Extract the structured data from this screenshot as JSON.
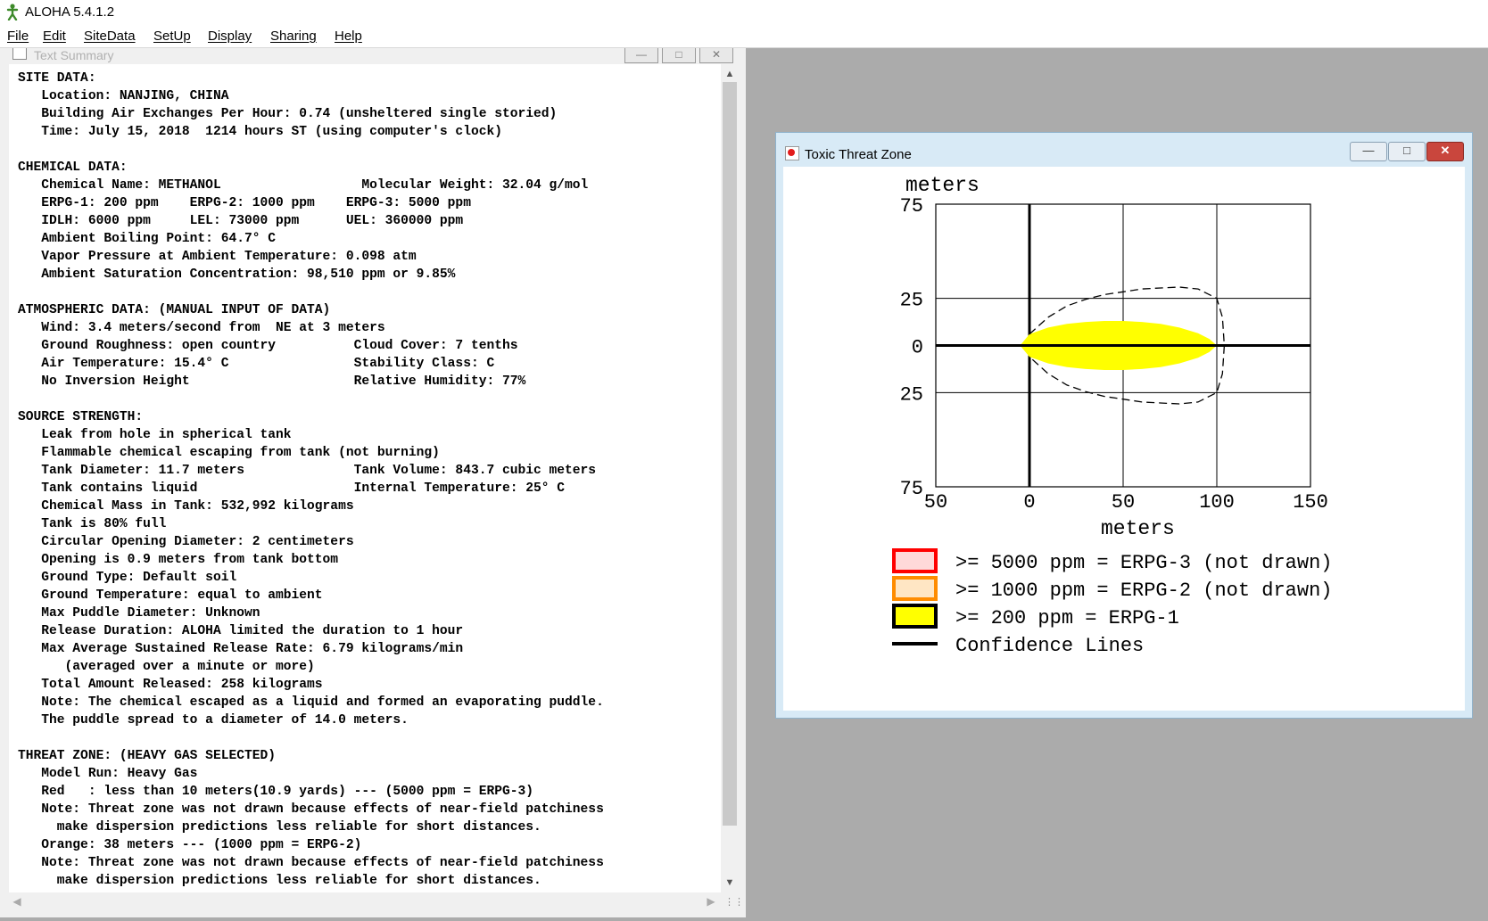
{
  "app": {
    "title": "ALOHA 5.4.1.2",
    "menu": [
      "File",
      "Edit",
      "SiteData",
      "SetUp",
      "Display",
      "Sharing",
      "Help"
    ]
  },
  "text_summary": {
    "title": "Text Summary",
    "lines": [
      "SITE DATA:",
      "   Location: NANJING, CHINA",
      "   Building Air Exchanges Per Hour: 0.74 (unsheltered single storied)",
      "   Time: July 15, 2018  1214 hours ST (using computer's clock)",
      "",
      "CHEMICAL DATA:",
      "   Chemical Name: METHANOL                  Molecular Weight: 32.04 g/mol",
      "   ERPG-1: 200 ppm    ERPG-2: 1000 ppm    ERPG-3: 5000 ppm",
      "   IDLH: 6000 ppm     LEL: 73000 ppm      UEL: 360000 ppm",
      "   Ambient Boiling Point: 64.7° C",
      "   Vapor Pressure at Ambient Temperature: 0.098 atm",
      "   Ambient Saturation Concentration: 98,510 ppm or 9.85%",
      "",
      "ATMOSPHERIC DATA: (MANUAL INPUT OF DATA)",
      "   Wind: 3.4 meters/second from  NE at 3 meters",
      "   Ground Roughness: open country          Cloud Cover: 7 tenths",
      "   Air Temperature: 15.4° C                Stability Class: C",
      "   No Inversion Height                     Relative Humidity: 77%",
      "",
      "SOURCE STRENGTH:",
      "   Leak from hole in spherical tank",
      "   Flammable chemical escaping from tank (not burning)",
      "   Tank Diameter: 11.7 meters              Tank Volume: 843.7 cubic meters",
      "   Tank contains liquid                    Internal Temperature: 25° C",
      "   Chemical Mass in Tank: 532,992 kilograms",
      "   Tank is 80% full",
      "   Circular Opening Diameter: 2 centimeters",
      "   Opening is 0.9 meters from tank bottom",
      "   Ground Type: Default soil",
      "   Ground Temperature: equal to ambient",
      "   Max Puddle Diameter: Unknown",
      "   Release Duration: ALOHA limited the duration to 1 hour",
      "   Max Average Sustained Release Rate: 6.79 kilograms/min",
      "      (averaged over a minute or more)",
      "   Total Amount Released: 258 kilograms",
      "   Note: The chemical escaped as a liquid and formed an evaporating puddle.",
      "   The puddle spread to a diameter of 14.0 meters.",
      "",
      "THREAT ZONE: (HEAVY GAS SELECTED)",
      "   Model Run: Heavy Gas",
      "   Red   : less than 10 meters(10.9 yards) --- (5000 ppm = ERPG-3)",
      "   Note: Threat zone was not drawn because effects of near-field patchiness",
      "     make dispersion predictions less reliable for short distances.",
      "   Orange: 38 meters --- (1000 ppm = ERPG-2)",
      "   Note: Threat zone was not drawn because effects of near-field patchiness",
      "     make dispersion predictions less reliable for short distances."
    ]
  },
  "threat_zone": {
    "title": "Toxic Threat Zone",
    "icon": "red-dot-icon",
    "legend": [
      {
        "label": ">= 5000 ppm = ERPG-3 (not drawn)",
        "color": "#ff0000"
      },
      {
        "label": ">= 1000 ppm = ERPG-2 (not drawn)",
        "color": "#ff8c00"
      },
      {
        "label": ">= 200 ppm = ERPG-1",
        "color": "#ffff00"
      },
      {
        "label": "Confidence Lines",
        "color": "#000000"
      }
    ]
  },
  "chart_data": {
    "type": "area",
    "xlabel": "meters",
    "ylabel": "meters",
    "xlim": [
      -50,
      150
    ],
    "ylim": [
      -75,
      75
    ],
    "x_ticks": [
      "50",
      "0",
      "50",
      "100",
      "150"
    ],
    "y_ticks": [
      "75",
      "25",
      "0",
      "25",
      "75"
    ],
    "grid": true,
    "series": [
      {
        "name": ">= 200 ppm = ERPG-1",
        "color": "#ffff00",
        "x": [
          -5,
          0,
          10,
          20,
          30,
          40,
          50,
          60,
          70,
          80,
          90,
          96,
          100,
          96,
          90,
          80,
          70,
          60,
          50,
          40,
          30,
          20,
          10,
          0,
          -5
        ],
        "y": [
          0,
          6,
          9.5,
          11.5,
          12.5,
          13,
          13,
          12.5,
          11.5,
          9.5,
          6.5,
          3.5,
          0,
          -3.5,
          -6.5,
          -9.5,
          -11.5,
          -12.5,
          -13,
          -13,
          -12.5,
          -11.5,
          -9.5,
          -6,
          0
        ]
      },
      {
        "name": "Confidence Lines",
        "color": "#000000",
        "x": [
          0,
          10,
          20,
          30,
          40,
          50,
          60,
          70,
          80,
          90,
          100,
          103,
          104,
          103,
          100,
          90,
          80,
          70,
          60,
          50,
          40,
          30,
          20,
          10,
          0
        ],
        "y": [
          6,
          15,
          21,
          24.5,
          27,
          28.5,
          30,
          30.5,
          31,
          30,
          25,
          15,
          0,
          -15,
          -25,
          -30,
          -31,
          -30.5,
          -30,
          -28.5,
          -27,
          -24.5,
          -21,
          -15,
          -6
        ]
      }
    ]
  }
}
